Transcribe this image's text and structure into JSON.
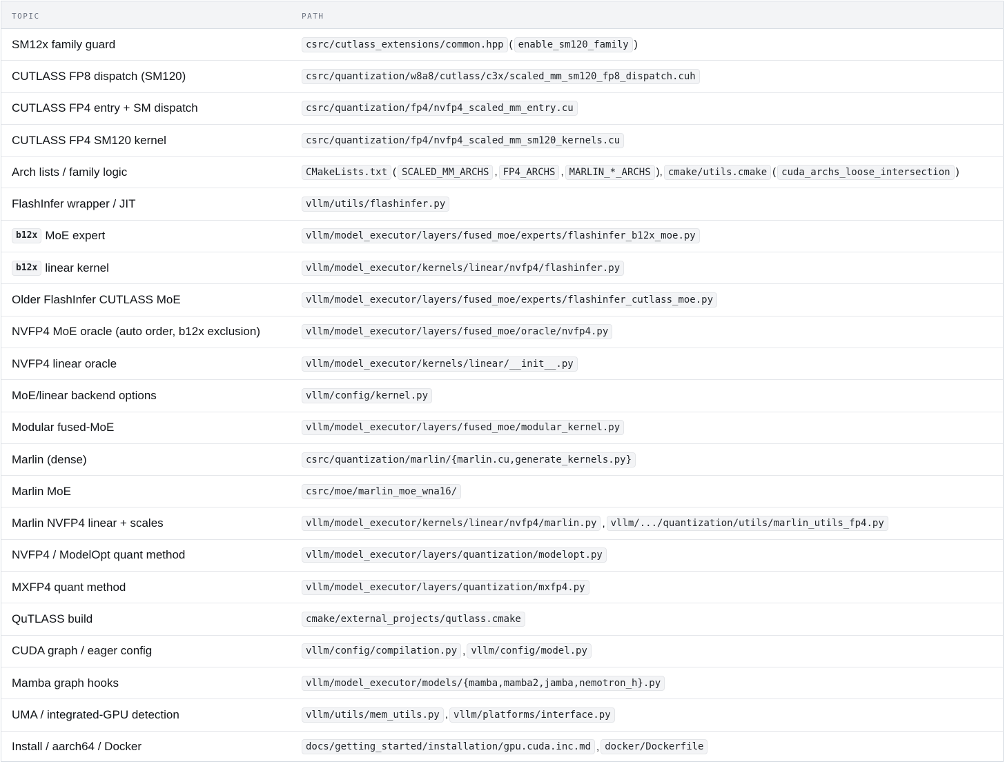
{
  "header": {
    "topic": "TOPIC",
    "path": "PATH"
  },
  "rows": [
    {
      "topic": "SM12x family guard",
      "path": [
        {
          "t": "code",
          "v": "csrc/cutlass_extensions/common.hpp"
        },
        {
          "t": "text",
          "v": " ("
        },
        {
          "t": "code",
          "v": "enable_sm120_family"
        },
        {
          "t": "text",
          "v": ")"
        }
      ]
    },
    {
      "topic": "CUTLASS FP8 dispatch (SM120)",
      "path": [
        {
          "t": "code",
          "v": "csrc/quantization/w8a8/cutlass/c3x/scaled_mm_sm120_fp8_dispatch.cuh"
        }
      ]
    },
    {
      "topic": "CUTLASS FP4 entry + SM dispatch",
      "path": [
        {
          "t": "code",
          "v": "csrc/quantization/fp4/nvfp4_scaled_mm_entry.cu"
        }
      ]
    },
    {
      "topic": "CUTLASS FP4 SM120 kernel",
      "path": [
        {
          "t": "code",
          "v": "csrc/quantization/fp4/nvfp4_scaled_mm_sm120_kernels.cu"
        }
      ]
    },
    {
      "topic": "Arch lists / family logic",
      "path": [
        {
          "t": "code",
          "v": "CMakeLists.txt"
        },
        {
          "t": "text",
          "v": " ("
        },
        {
          "t": "code",
          "v": "SCALED_MM_ARCHS"
        },
        {
          "t": "text",
          "v": ", "
        },
        {
          "t": "code",
          "v": "FP4_ARCHS"
        },
        {
          "t": "text",
          "v": ", "
        },
        {
          "t": "code",
          "v": "MARLIN_*_ARCHS"
        },
        {
          "t": "text",
          "v": "), "
        },
        {
          "t": "code",
          "v": "cmake/utils.cmake"
        },
        {
          "t": "text",
          "v": " ("
        },
        {
          "t": "code",
          "v": "cuda_archs_loose_intersection"
        },
        {
          "t": "text",
          "v": ")"
        }
      ]
    },
    {
      "topic": "FlashInfer wrapper / JIT",
      "path": [
        {
          "t": "code",
          "v": "vllm/utils/flashinfer.py"
        }
      ]
    },
    {
      "topic_code": "b12x",
      "topic": "MoE expert",
      "path": [
        {
          "t": "code",
          "v": "vllm/model_executor/layers/fused_moe/experts/flashinfer_b12x_moe.py"
        }
      ]
    },
    {
      "topic_code": "b12x",
      "topic": "linear kernel",
      "path": [
        {
          "t": "code",
          "v": "vllm/model_executor/kernels/linear/nvfp4/flashinfer.py"
        }
      ]
    },
    {
      "topic": "Older FlashInfer CUTLASS MoE",
      "path": [
        {
          "t": "code",
          "v": "vllm/model_executor/layers/fused_moe/experts/flashinfer_cutlass_moe.py"
        }
      ]
    },
    {
      "topic": "NVFP4 MoE oracle (auto order, b12x exclusion)",
      "path": [
        {
          "t": "code",
          "v": "vllm/model_executor/layers/fused_moe/oracle/nvfp4.py"
        }
      ]
    },
    {
      "topic": "NVFP4 linear oracle",
      "path": [
        {
          "t": "code",
          "v": "vllm/model_executor/kernels/linear/__init__.py"
        }
      ]
    },
    {
      "topic": "MoE/linear backend options",
      "path": [
        {
          "t": "code",
          "v": "vllm/config/kernel.py"
        }
      ]
    },
    {
      "topic": "Modular fused-MoE",
      "path": [
        {
          "t": "code",
          "v": "vllm/model_executor/layers/fused_moe/modular_kernel.py"
        }
      ]
    },
    {
      "topic": "Marlin (dense)",
      "path": [
        {
          "t": "code",
          "v": "csrc/quantization/marlin/{marlin.cu,generate_kernels.py}"
        }
      ]
    },
    {
      "topic": "Marlin MoE",
      "path": [
        {
          "t": "code",
          "v": "csrc/moe/marlin_moe_wna16/"
        }
      ]
    },
    {
      "topic": "Marlin NVFP4 linear + scales",
      "path": [
        {
          "t": "code",
          "v": "vllm/model_executor/kernels/linear/nvfp4/marlin.py"
        },
        {
          "t": "text",
          "v": ", "
        },
        {
          "t": "code",
          "v": "vllm/.../quantization/utils/marlin_utils_fp4.py"
        }
      ]
    },
    {
      "topic": "NVFP4 / ModelOpt quant method",
      "path": [
        {
          "t": "code",
          "v": "vllm/model_executor/layers/quantization/modelopt.py"
        }
      ]
    },
    {
      "topic": "MXFP4 quant method",
      "path": [
        {
          "t": "code",
          "v": "vllm/model_executor/layers/quantization/mxfp4.py"
        }
      ]
    },
    {
      "topic": "QuTLASS build",
      "path": [
        {
          "t": "code",
          "v": "cmake/external_projects/qutlass.cmake"
        }
      ]
    },
    {
      "topic": "CUDA graph / eager config",
      "path": [
        {
          "t": "code",
          "v": "vllm/config/compilation.py"
        },
        {
          "t": "text",
          "v": ", "
        },
        {
          "t": "code",
          "v": "vllm/config/model.py"
        }
      ]
    },
    {
      "topic": "Mamba graph hooks",
      "path": [
        {
          "t": "code",
          "v": "vllm/model_executor/models/{mamba,mamba2,jamba,nemotron_h}.py"
        }
      ]
    },
    {
      "topic": "UMA / integrated-GPU detection",
      "path": [
        {
          "t": "code",
          "v": "vllm/utils/mem_utils.py"
        },
        {
          "t": "text",
          "v": ", "
        },
        {
          "t": "code",
          "v": "vllm/platforms/interface.py"
        }
      ]
    },
    {
      "topic": "Install / aarch64 / Docker",
      "path": [
        {
          "t": "code",
          "v": "docs/getting_started/installation/gpu.cuda.inc.md"
        },
        {
          "t": "text",
          "v": ", "
        },
        {
          "t": "code",
          "v": "docker/Dockerfile"
        }
      ]
    }
  ]
}
